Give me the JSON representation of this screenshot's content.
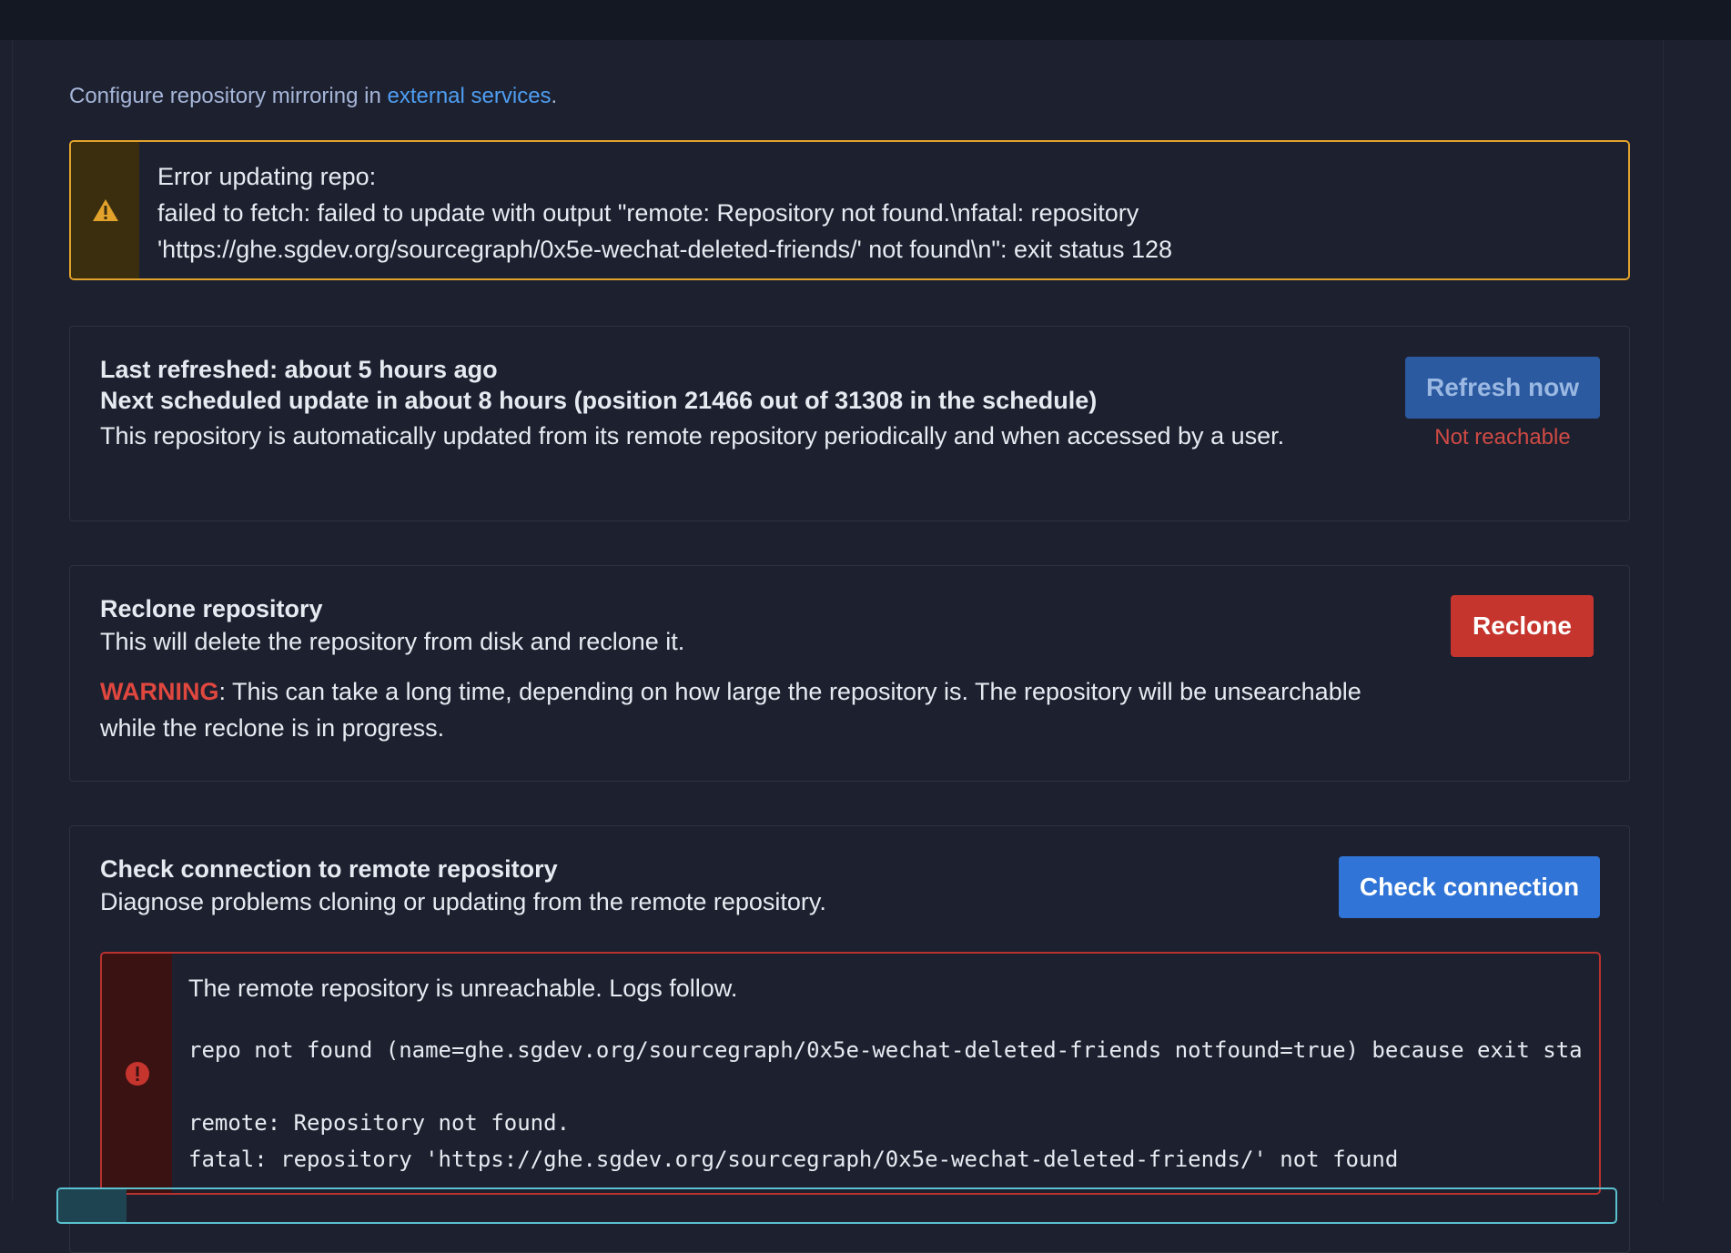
{
  "config": {
    "prefix": "Configure repository mirroring in ",
    "link": "external services",
    "suffix": "."
  },
  "update_error": {
    "icon": "warning-icon",
    "title": "Error updating repo:",
    "line1": "failed to fetch: failed to update with output \"remote: Repository not found.\\nfatal: repository",
    "line2": "'https://ghe.sgdev.org/sourcegraph/0x5e-wechat-deleted-friends/' not found\\n\": exit status 128"
  },
  "refresh": {
    "last_refreshed": "Last refreshed: about 5 hours ago",
    "next_update": "Next scheduled update in about 8 hours (position 21466 out of 31308 in the schedule)",
    "description": "This repository is automatically updated from its remote repository periodically and when accessed by a user.",
    "button": "Refresh now",
    "status": "Not reachable"
  },
  "reclone": {
    "title": "Reclone repository",
    "description": "This will delete the repository from disk and reclone it.",
    "warning_label": "WARNING",
    "warning_text": ": This can take a long time, depending on how large the repository is. The repository will be unsearchable while the reclone is in progress.",
    "button": "Reclone"
  },
  "check": {
    "title": "Check connection to remote repository",
    "description": "Diagnose problems cloning or updating from the remote repository.",
    "button": "Check connection",
    "alert": {
      "icon": "error-icon",
      "message": "The remote repository is unreachable. Logs follow.",
      "log1": "repo not found (name=ghe.sgdev.org/sourcegraph/0x5e-wechat-deleted-friends notfound=true) because exit sta",
      "log2": "remote: Repository not found.",
      "log3": "fatal: repository 'https://ghe.sgdev.org/sourcegraph/0x5e-wechat-deleted-friends/' not found"
    }
  },
  "colors": {
    "background": "#1d212f",
    "warning": "#e2a22b",
    "danger": "#c5352e",
    "primary": "#2f74d6",
    "link": "#4f9ef3"
  }
}
